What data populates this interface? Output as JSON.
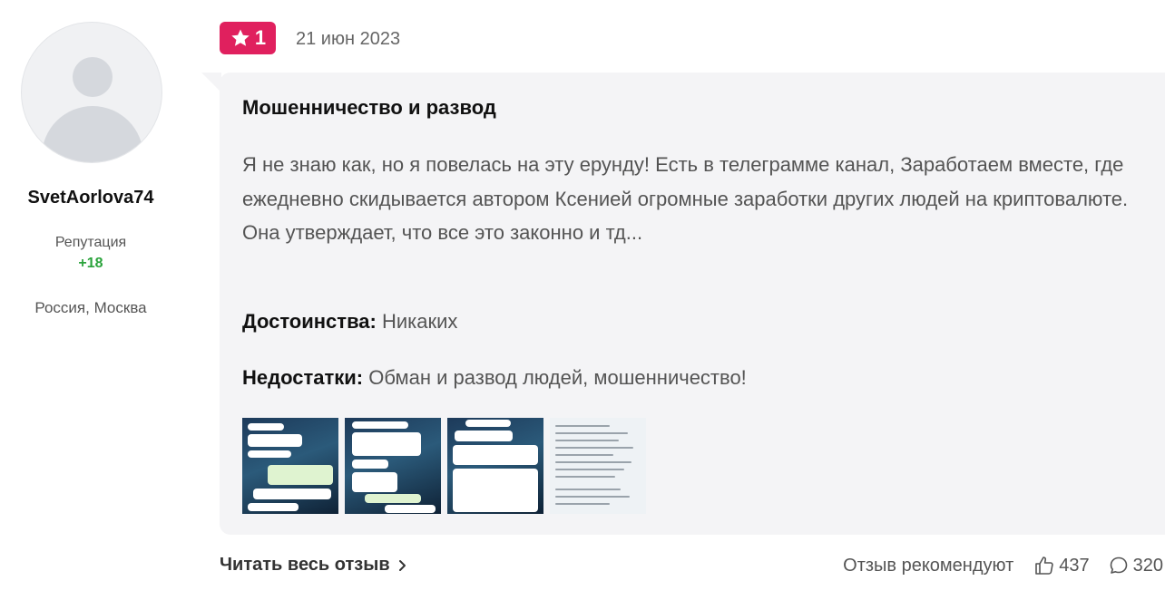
{
  "author": {
    "username": "SvetAorlova74",
    "reputation_label": "Репутация",
    "reputation_value": "+18",
    "location": "Россия, Москва"
  },
  "review": {
    "rating": "1",
    "date": "21 июн 2023",
    "title": "Мошенничество и развод",
    "text": "Я не знаю как, но я повелась на эту ерунду! Есть в телеграмме канал, Заработаем вместе, где ежедневно скидывается автором Ксенией огромные заработки других людей на криптовалюте. Она утверждает, что все это законно и тд...",
    "pros_label": "Достоинства:",
    "pros_value": "Никаких",
    "cons_label": "Недостатки:",
    "cons_value": "Обман и развод людей, мошенничество!",
    "images": [
      "chat-screenshot",
      "chat-screenshot",
      "chat-screenshot",
      "chat-screenshot"
    ]
  },
  "footer": {
    "read_more": "Читать весь отзыв",
    "recommend_label": "Отзыв рекомендуют",
    "likes": "437",
    "comments": "320"
  },
  "colors": {
    "badge": "#e0205e",
    "reputation": "#2aa33b",
    "card_bg": "#f4f4f6"
  }
}
